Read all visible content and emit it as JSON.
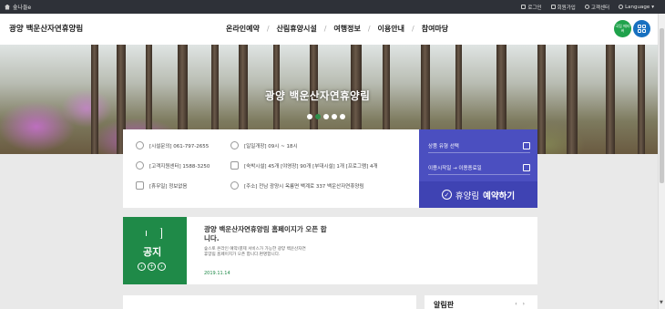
{
  "topbar": {
    "site_label": "숲나들e",
    "links": [
      "로그인",
      "회원가입",
      "고객센터",
      "Language"
    ]
  },
  "header": {
    "logo": "광양 백운산자연휴양림",
    "nav": [
      "온라인예약",
      "산림휴양시설",
      "여행정보",
      "이용안내",
      "참여마당"
    ],
    "green_button": "국립 메타버",
    "sep": "/"
  },
  "hero": {
    "title": "광양 백운산자연휴양림",
    "slides": 5,
    "active_slide": 1
  },
  "info": {
    "contact": "[시설문의] 061-797-2655",
    "hours": "[일일개장] 09시 ~ 18시",
    "support": "[고객지원센터] 1588-3250",
    "lodging": "[숙박시설] 45개 [야영장] 90개 [부대시설] 1개 [프로그램] 4개",
    "closed": "[휴무일] 정보없음",
    "address": "[주소] 전남 광양시 옥룡면 백계로 337 백운산자연휴양림"
  },
  "reserve": {
    "select_facility": "상품 유형 선택",
    "date_start": "이용시작일",
    "arrow": "→",
    "date_end": "이용종료일",
    "button_light": "휴양림",
    "button_bold": "예약하기"
  },
  "notice": {
    "badge": "공지",
    "headline": "광양 백운산자연휴양림 홈페이지가 오픈 합니다.",
    "body": "숲스토 온라인 예약/결제 서비스가 가능한 광양 백운산자연휴양림 홈페이지가 오픈 합니다.편명합니다.",
    "date": "2019.11.14",
    "controls": [
      "‹",
      "+",
      "›"
    ]
  },
  "bottom": {
    "card2_title": "알림판",
    "card2_arrows": "‹ ›"
  },
  "colors": {
    "topbar": "#2e3138",
    "reserve": "#4b4fc0",
    "notice": "#1f8a48"
  }
}
